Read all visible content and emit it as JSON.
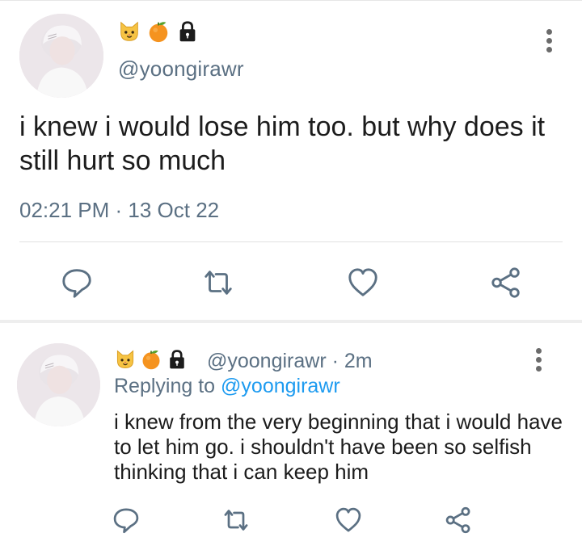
{
  "main_tweet": {
    "emoji_icons": [
      "cat-face-icon",
      "tangerine-icon",
      "lock-icon"
    ],
    "handle": "@yoongirawr",
    "text": "i knew i would lose him too. but why does it still hurt so much",
    "timestamp": "02:21 PM · 13 Oct 22",
    "actions": [
      "reply-icon",
      "retweet-icon",
      "like-icon",
      "share-icon"
    ]
  },
  "reply": {
    "emoji_icons": [
      "cat-face-icon",
      "tangerine-icon",
      "lock-icon"
    ],
    "handle_time": "@yoongirawr · 2m",
    "replying_prefix": "Replying to",
    "replying_to": "@yoongirawr",
    "text": "i knew from the very beginning that i would have to let him go. i shouldn't have been so selfish thinking that i can keep him",
    "actions": [
      "reply-icon",
      "retweet-icon",
      "like-icon",
      "share-icon"
    ]
  },
  "colors": {
    "text": "#1c1c1c",
    "secondary": "#5b7083",
    "link": "#1d9bf0",
    "icon": "#5b7083",
    "divider": "#e1e1e1"
  }
}
